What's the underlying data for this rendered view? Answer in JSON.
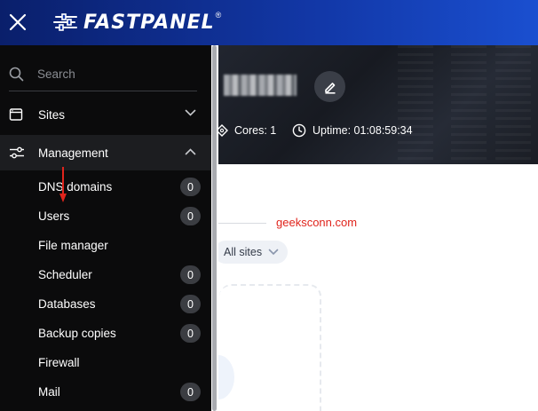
{
  "header": {
    "logo_text": "FASTPANEL",
    "logo_reg": "®"
  },
  "search": {
    "placeholder": "Search"
  },
  "sidebar": {
    "sections": {
      "sites": {
        "label": "Sites"
      },
      "management": {
        "label": "Management"
      }
    },
    "management_items": [
      {
        "label": "DNS domains",
        "count": "0"
      },
      {
        "label": "Users",
        "count": "0"
      },
      {
        "label": "File manager"
      },
      {
        "label": "Scheduler",
        "count": "0"
      },
      {
        "label": "Databases",
        "count": "0"
      },
      {
        "label": "Backup copies",
        "count": "0"
      },
      {
        "label": "Firewall"
      },
      {
        "label": "Mail",
        "count": "0"
      }
    ]
  },
  "server": {
    "cores_label": "Cores: 1",
    "uptime_label": "Uptime: 01:08:59:34"
  },
  "filter": {
    "selected": "All sites"
  },
  "watermark": "geeksconn.com",
  "colors": {
    "header_blue": "#1238a8",
    "sidebar_bg": "#0b0b0c",
    "badge_bg": "#3b3d42",
    "watermark_red": "#e0241c"
  }
}
